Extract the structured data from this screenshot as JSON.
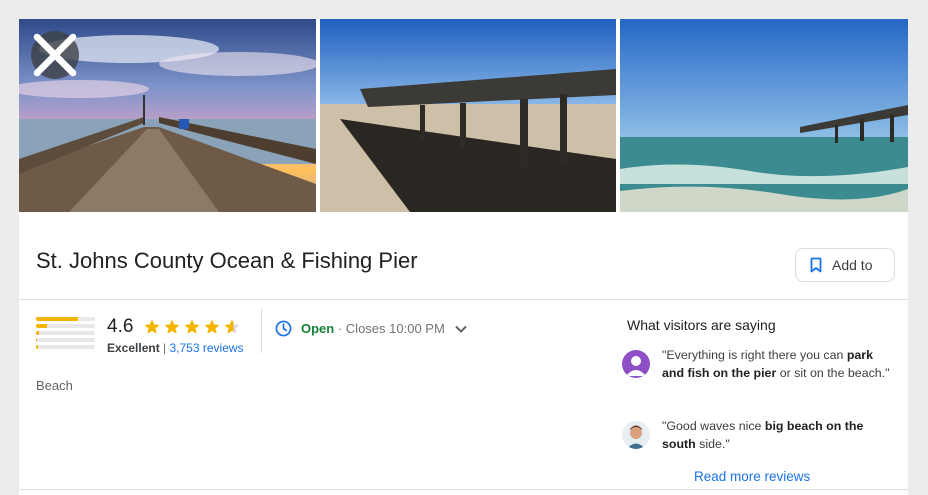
{
  "place": {
    "title": "St. Johns County Ocean & Fishing Pier",
    "category": "Beach"
  },
  "actions": {
    "close_icon": "close-icon",
    "add_to_label": "Add to",
    "add_to_icon": "bookmark-icon"
  },
  "photos": [
    {
      "name": "pier-sunset-photo"
    },
    {
      "name": "pier-shadow-photo"
    },
    {
      "name": "pier-ocean-photo"
    }
  ],
  "rating": {
    "value": "4.6",
    "stars": 4.6,
    "descriptor": "Excellent",
    "separator": " | ",
    "reviews_link": "3,753 reviews",
    "distribution": [
      0.72,
      0.18,
      0.05,
      0.02,
      0.03
    ]
  },
  "hours": {
    "status": "Open",
    "separator": " · ",
    "detail": "Closes 10:00 PM",
    "icon": "clock-icon",
    "expand_icon": "chevron-down-icon"
  },
  "visitors": {
    "heading": "What visitors are saying",
    "reviews": [
      {
        "parts": [
          {
            "t": "\"Everything is right there you can ",
            "b": false
          },
          {
            "t": "park and fish on the pier",
            "b": true
          },
          {
            "t": " or sit on the beach.\"",
            "b": false
          }
        ]
      },
      {
        "parts": [
          {
            "t": "\"Good waves nice ",
            "b": false
          },
          {
            "t": "big beach on the south",
            "b": true
          },
          {
            "t": " side.\"",
            "b": false
          }
        ]
      }
    ],
    "read_more": "Read more reviews"
  },
  "colors": {
    "star": "#f4b400",
    "open": "#188038",
    "link": "#1a73e8",
    "clock": "#1a73e8"
  }
}
